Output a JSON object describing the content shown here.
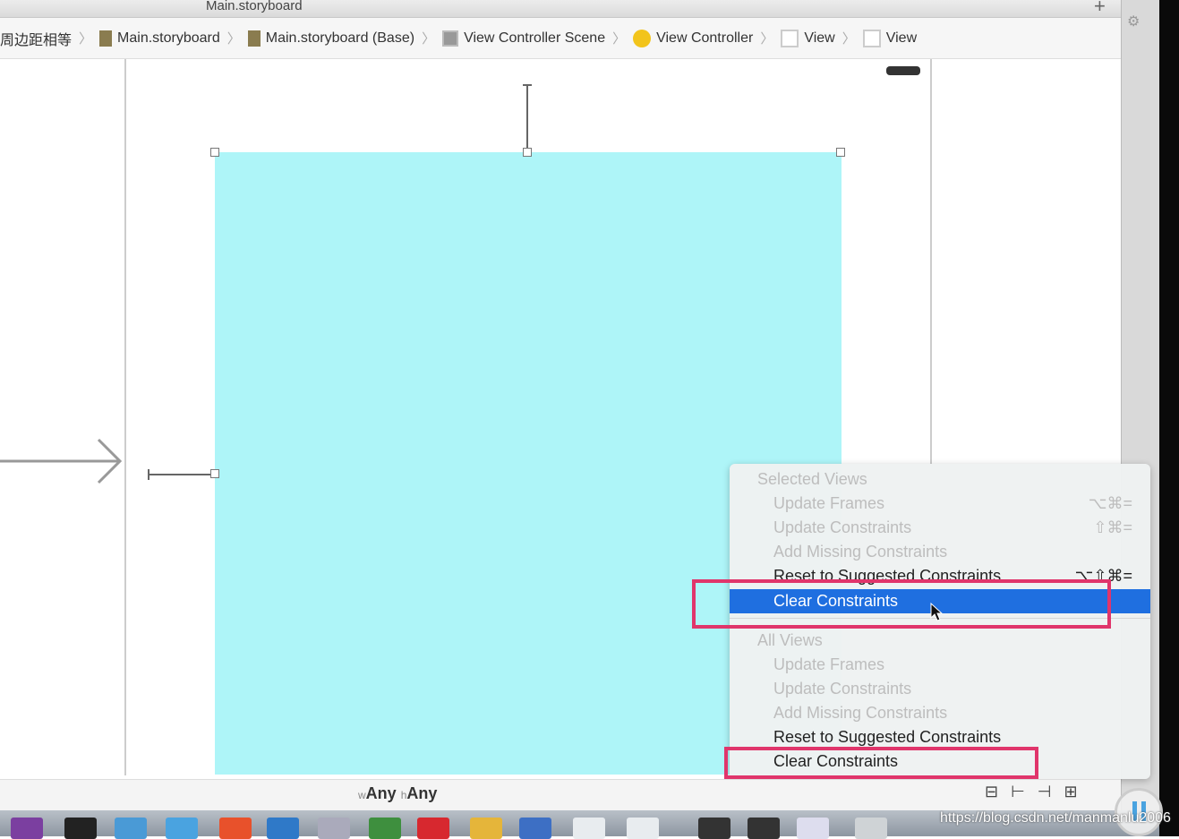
{
  "window": {
    "title": "Main.storyboard"
  },
  "breadcrumbs": [
    "周边距相等",
    "Main.storyboard",
    "Main.storyboard (Base)",
    "View Controller Scene",
    "View Controller",
    "View",
    "View"
  ],
  "size_class": {
    "w_prefix": "w",
    "w": "Any",
    "h_prefix": "h",
    "h": "Any"
  },
  "menu": {
    "selected_header": "Selected Views",
    "selected_items": [
      {
        "label": "Update Frames",
        "shortcut": "⌥⌘=",
        "enabled": false
      },
      {
        "label": "Update Constraints",
        "shortcut": "⇧⌘=",
        "enabled": false
      },
      {
        "label": "Add Missing Constraints",
        "shortcut": "",
        "enabled": false
      },
      {
        "label": "Reset to Suggested Constraints",
        "shortcut": "⌥⇧⌘=",
        "enabled": true
      },
      {
        "label": "Clear Constraints",
        "shortcut": "",
        "enabled": true,
        "highlighted": true
      }
    ],
    "all_header": "All Views",
    "all_items": [
      {
        "label": "Update Frames",
        "enabled": false
      },
      {
        "label": "Update Constraints",
        "enabled": false
      },
      {
        "label": "Add Missing Constraints",
        "enabled": false
      },
      {
        "label": "Reset to Suggested Constraints",
        "enabled": true
      },
      {
        "label": "Clear Constraints",
        "enabled": true
      }
    ]
  },
  "colors": {
    "view_background": "#aef5f8",
    "highlight": "#1f6fe0",
    "annotation_box": "#e0356b"
  },
  "watermark": "https://blog.csdn.net/manmanlu2006"
}
